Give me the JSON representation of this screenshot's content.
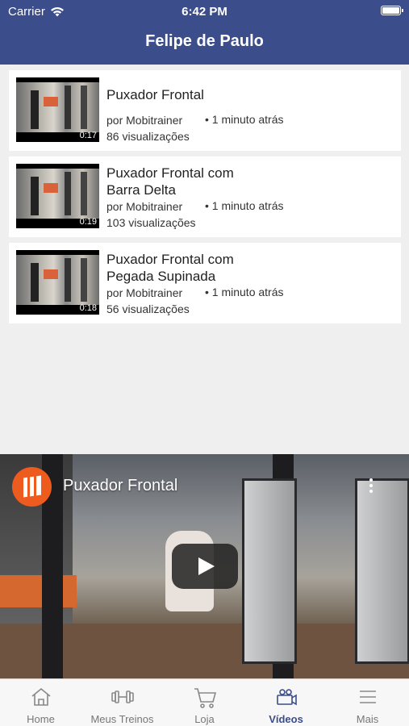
{
  "status": {
    "carrier": "Carrier",
    "time": "6:42 PM"
  },
  "nav": {
    "title": "Felipe de Paulo"
  },
  "videos": [
    {
      "title": "Puxador Frontal",
      "duration": "0:17",
      "author": "por Mobitrainer",
      "ago": "• 1 minuto atrás",
      "views": "86 visualizações"
    },
    {
      "title": "Puxador Frontal com Barra Delta",
      "duration": "0:19",
      "author": "por Mobitrainer",
      "ago": "• 1 minuto atrás",
      "views": "103 visualizações"
    },
    {
      "title": "Puxador Frontal com Pegada Supinada",
      "duration": "0:18",
      "author": "por Mobitrainer",
      "ago": "• 1 minuto atrás",
      "views": "56 visualizações"
    }
  ],
  "player": {
    "title": "Puxador Frontal"
  },
  "tabs": [
    {
      "label": "Home",
      "icon": "home-icon"
    },
    {
      "label": "Meus Treinos",
      "icon": "dumbbell-icon"
    },
    {
      "label": "Loja",
      "icon": "cart-icon"
    },
    {
      "label": "Vídeos",
      "icon": "video-camera-icon"
    },
    {
      "label": "Mais",
      "icon": "menu-icon"
    }
  ],
  "colors": {
    "header": "#3b4d8a",
    "accent": "#3b4d8a",
    "logo": "#ee5b1f"
  }
}
